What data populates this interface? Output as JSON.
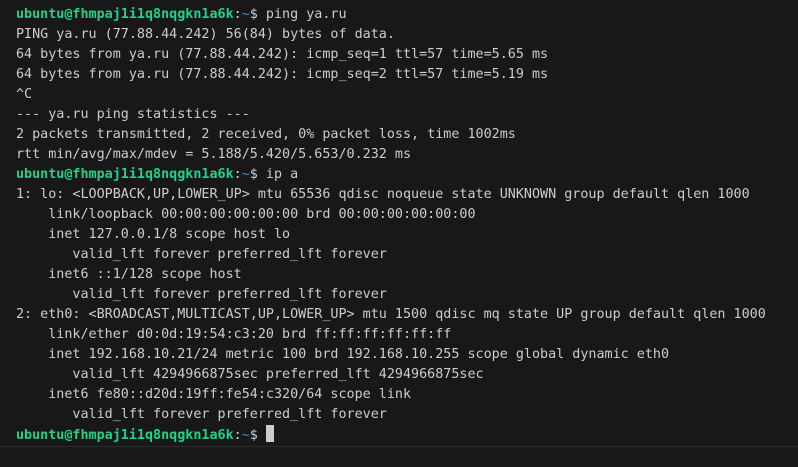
{
  "prompt": {
    "user_host": "ubuntu@fhmpaj1i1q8nqgkn1a6k",
    "colon": ":",
    "path": "~",
    "symbol": "$"
  },
  "commands": {
    "ping": " ping ya.ru",
    "ip": " ip a"
  },
  "ping_output": [
    "PING ya.ru (77.88.44.242) 56(84) bytes of data.",
    "64 bytes from ya.ru (77.88.44.242): icmp_seq=1 ttl=57 time=5.65 ms",
    "64 bytes from ya.ru (77.88.44.242): icmp_seq=2 ttl=57 time=5.19 ms",
    "^C",
    "--- ya.ru ping statistics ---",
    "2 packets transmitted, 2 received, 0% packet loss, time 1002ms",
    "rtt min/avg/max/mdev = 5.188/5.420/5.653/0.232 ms"
  ],
  "ip_output": [
    "1: lo: <LOOPBACK,UP,LOWER_UP> mtu 65536 qdisc noqueue state UNKNOWN group default qlen 1000",
    "    link/loopback 00:00:00:00:00:00 brd 00:00:00:00:00:00",
    "    inet 127.0.0.1/8 scope host lo",
    "       valid_lft forever preferred_lft forever",
    "    inet6 ::1/128 scope host",
    "       valid_lft forever preferred_lft forever",
    "2: eth0: <BROADCAST,MULTICAST,UP,LOWER_UP> mtu 1500 qdisc mq state UP group default qlen 1000",
    "    link/ether d0:0d:19:54:c3:20 brd ff:ff:ff:ff:ff:ff",
    "    inet 192.168.10.21/24 metric 100 brd 192.168.10.255 scope global dynamic eth0",
    "       valid_lft 4294966875sec preferred_lft 4294966875sec",
    "    inet6 fe80::d20d:19ff:fe54:c320/64 scope link",
    "       valid_lft forever preferred_lft forever"
  ],
  "colors": {
    "background": "#181818",
    "foreground": "#cccccc",
    "user_host": "#23d18b",
    "path": "#3b8eea"
  }
}
